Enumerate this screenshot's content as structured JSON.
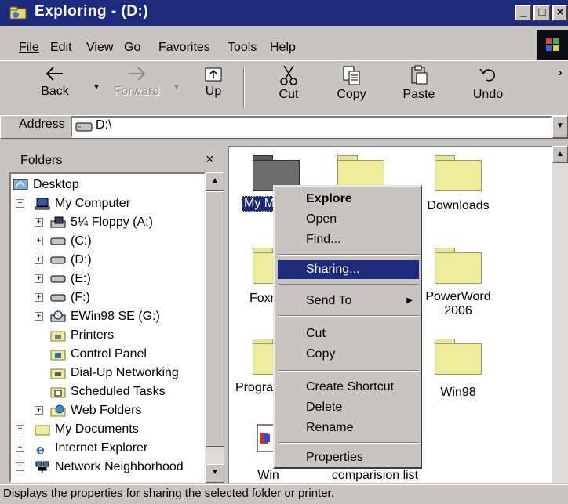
{
  "window": {
    "title": "Exploring - (D:)"
  },
  "colors": {
    "title_bar": "#1c2a7e",
    "chrome": "#c8c4c0",
    "selection": "#1c2a7e",
    "folder": "#ecec9a"
  },
  "menu": [
    {
      "label": "File"
    },
    {
      "label": "Edit"
    },
    {
      "label": "View"
    },
    {
      "label": "Go"
    },
    {
      "label": "Favorites"
    },
    {
      "label": "Tools"
    },
    {
      "label": "Help"
    }
  ],
  "toolbar": {
    "back": "Back",
    "forward": "Forward",
    "up": "Up",
    "cut": "Cut",
    "copy": "Copy",
    "paste": "Paste",
    "undo": "Undo"
  },
  "address": {
    "label": "Address",
    "value": "D:\\"
  },
  "folders_pane": {
    "title": "Folders",
    "tree": [
      "Desktop",
      "My Computer",
      "5¼ Floppy (A:)",
      "(C:)",
      "(D:)",
      "(E:)",
      "(F:)",
      "EWin98 SE (G:)",
      "Printers",
      "Control Panel",
      "Dial-Up Networking",
      "Scheduled Tasks",
      "Web Folders",
      "My Documents",
      "Internet Explorer",
      "Network Neighborhood"
    ]
  },
  "files": {
    "my_music": "My Music",
    "downloads": "Downloads",
    "foxmail": "Foxmail",
    "powerword_1": "PowerWord",
    "powerword_2": "2006",
    "programs": "Programs",
    "win98": "Win98",
    "win": "Win",
    "comparison": "comparision list"
  },
  "context_menu": {
    "explore": "Explore",
    "open": "Open",
    "find": "Find...",
    "sharing": "Sharing...",
    "send_to": "Send To",
    "cut": "Cut",
    "copy": "Copy",
    "create_shortcut": "Create Shortcut",
    "delete": "Delete",
    "rename": "Rename",
    "properties": "Properties"
  },
  "status": {
    "text": "Displays the properties for sharing the selected folder or printer."
  }
}
